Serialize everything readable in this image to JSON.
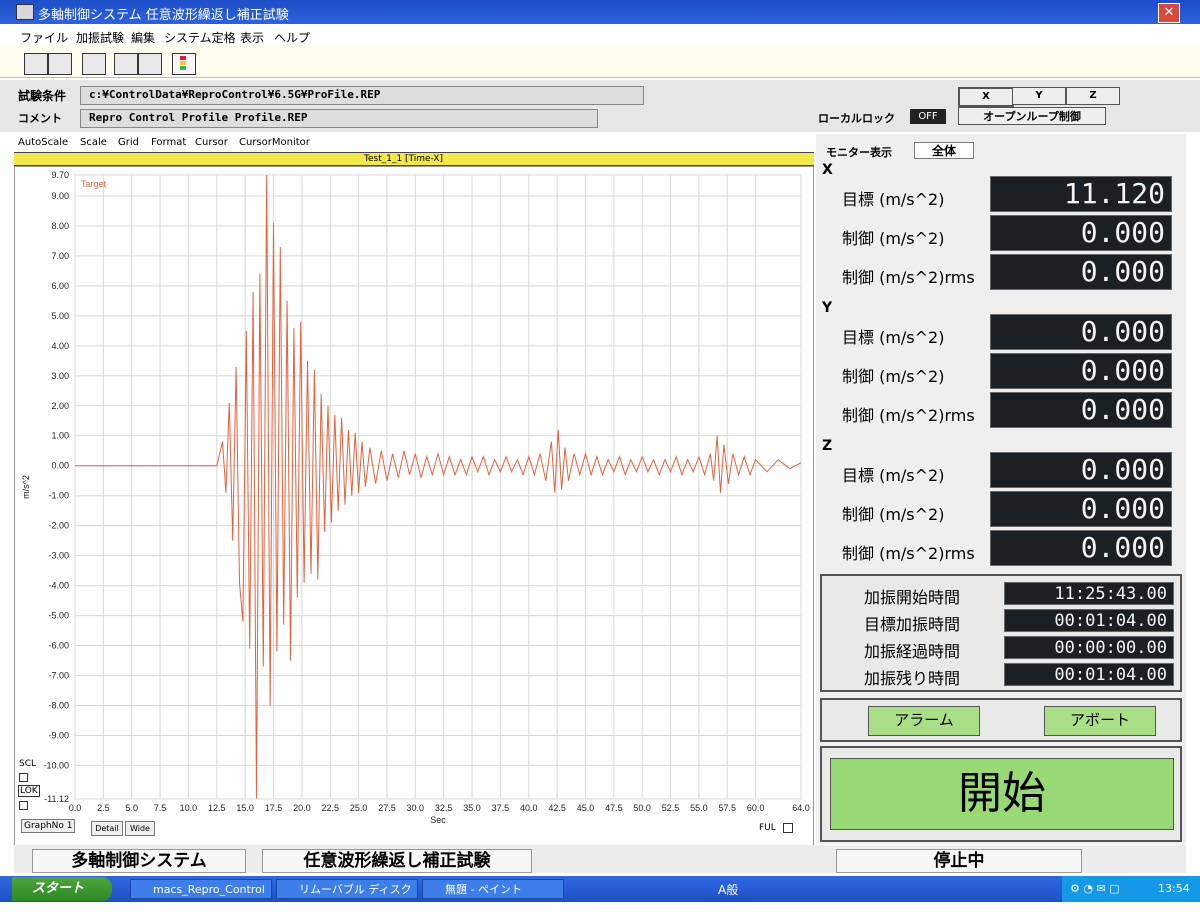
{
  "window": {
    "title": "多軸制御システム 任意波形繰返し補正試験"
  },
  "menu": [
    "ファイル",
    "加振試験",
    "編集",
    "システム定格",
    "表示",
    "ヘルプ"
  ],
  "conditions": {
    "label": "試験条件",
    "path": "c:¥ControlData¥ReproControl¥6.5G¥ProFile.REP",
    "comment_label": "コメント",
    "comment": "Repro Control Profile Profile.REP",
    "local_lock_label": "ローカルロック",
    "local_lock_state": "OFF",
    "open_loop_button": "オープンループ制御"
  },
  "axis_buttons": [
    "X",
    "Y",
    "Z"
  ],
  "graph": {
    "menu": [
      "AutoScale",
      "Scale",
      "Grid",
      "Format",
      "Cursor",
      "CursorMonitor"
    ],
    "title": "Test_1_1 [Time-X]",
    "scl_label": "SCL",
    "lok_label": "LOK",
    "graph_no": "GraphNo 1",
    "detail_button": "Detail",
    "wide_button": "Wide",
    "ful_label": "FUL"
  },
  "chart_data": {
    "type": "line",
    "title": "Test_1_1 [Time-X]",
    "xlabel": "Sec",
    "ylabel": "m/s^2",
    "xlim": [
      0,
      64
    ],
    "ylim": [
      -11.12,
      9.7
    ],
    "x_ticks": [
      "0.0",
      "2.5",
      "5.0",
      "7.5",
      "10.0",
      "12.5",
      "15.0",
      "17.5",
      "20.0",
      "22.5",
      "25.0",
      "27.5",
      "30.0",
      "32.5",
      "35.0",
      "37.5",
      "40.0",
      "42.5",
      "45.0",
      "47.5",
      "50.0",
      "52.5",
      "55.0",
      "57.5",
      "60.0",
      "64.0"
    ],
    "x_tick_values": [
      0,
      2.5,
      5,
      7.5,
      10,
      12.5,
      15,
      17.5,
      20,
      22.5,
      25,
      27.5,
      30,
      32.5,
      35,
      37.5,
      40,
      42.5,
      45,
      47.5,
      50,
      52.5,
      55,
      57.5,
      60,
      64
    ],
    "y_ticks": [
      "9.70",
      "9.00",
      "8.00",
      "7.00",
      "6.00",
      "5.00",
      "4.00",
      "3.00",
      "2.00",
      "1.00",
      "0.00",
      "-1.00",
      "-2.00",
      "-3.00",
      "-4.00",
      "-5.00",
      "-6.00",
      "-7.00",
      "-8.00",
      "-9.00",
      "-10.00",
      "-11.12"
    ],
    "y_tick_values": [
      9.7,
      9,
      8,
      7,
      6,
      5,
      4,
      3,
      2,
      1,
      0,
      -1,
      -2,
      -3,
      -4,
      -5,
      -6,
      -7,
      -8,
      -9,
      -10,
      -11.12
    ],
    "grid": true,
    "legend_position": "top-left",
    "series": [
      {
        "name": "Target",
        "color": "#e8603c",
        "x": [
          0,
          12.5,
          13,
          13.3,
          13.6,
          13.9,
          14.2,
          14.5,
          14.8,
          15.1,
          15.4,
          15.7,
          16.0,
          16.3,
          16.6,
          16.9,
          17.2,
          17.5,
          17.8,
          18.1,
          18.4,
          18.7,
          19.0,
          19.3,
          19.6,
          19.9,
          20.2,
          20.5,
          20.8,
          21.1,
          21.4,
          21.7,
          22.0,
          22.3,
          22.6,
          22.9,
          23.2,
          23.5,
          23.8,
          24.1,
          24.4,
          24.7,
          25.0,
          25.3,
          25.6,
          26.0,
          26.5,
          27.0,
          27.5,
          28.0,
          28.5,
          29.0,
          29.5,
          30.0,
          30.5,
          31.0,
          31.5,
          32.0,
          32.5,
          33.0,
          33.5,
          34.0,
          34.5,
          35.0,
          35.5,
          36.0,
          36.5,
          37.0,
          37.5,
          38.0,
          38.5,
          39.0,
          39.5,
          40.0,
          40.5,
          41.0,
          41.5,
          42.0,
          42.3,
          42.6,
          42.9,
          43.2,
          43.5,
          44.0,
          44.5,
          45.0,
          45.5,
          46.0,
          46.5,
          47.0,
          47.5,
          48.0,
          48.5,
          49.0,
          49.5,
          50.0,
          50.5,
          51.0,
          51.5,
          52.0,
          52.5,
          53.0,
          53.5,
          54.0,
          54.5,
          55.0,
          55.5,
          56.0,
          56.3,
          56.6,
          56.9,
          57.2,
          57.6,
          58.0,
          58.5,
          59.0,
          59.5,
          60.0,
          61.0,
          62.0,
          63.0,
          64.0
        ],
        "y": [
          0,
          0,
          0.8,
          -0.9,
          2.1,
          -2.5,
          3.3,
          -3.9,
          -5.2,
          4.5,
          -6.1,
          5.8,
          -11.1,
          6.4,
          -6.7,
          9.7,
          -8.0,
          8.1,
          -6.2,
          7.3,
          -5.3,
          5.5,
          -6.5,
          4.6,
          -4.4,
          4.8,
          -3.9,
          3.5,
          -3.6,
          3.2,
          -3.8,
          2.4,
          -2.2,
          2.0,
          -1.9,
          1.7,
          -1.5,
          1.6,
          -1.3,
          1.2,
          -1.0,
          1.1,
          -0.9,
          0.8,
          -0.7,
          0.6,
          -0.6,
          0.5,
          -0.5,
          0.4,
          -0.4,
          0.5,
          -0.3,
          0.4,
          -0.4,
          0.3,
          -0.3,
          0.4,
          -0.3,
          0.3,
          -0.3,
          0.2,
          -0.3,
          0.3,
          -0.2,
          0.3,
          -0.3,
          0.2,
          -0.2,
          0.3,
          -0.2,
          0.2,
          -0.3,
          0.3,
          -0.3,
          0.4,
          -0.5,
          0.8,
          -0.9,
          1.2,
          -0.8,
          0.6,
          -0.5,
          0.4,
          -0.3,
          0.4,
          -0.3,
          0.3,
          -0.3,
          0.2,
          -0.2,
          0.3,
          -0.3,
          0.2,
          -0.2,
          0.3,
          -0.2,
          0.2,
          -0.3,
          0.2,
          -0.2,
          0.3,
          -0.3,
          0.2,
          -0.2,
          0.3,
          -0.3,
          0.4,
          -0.5,
          1.0,
          -0.9,
          0.7,
          -0.6,
          0.4,
          -0.3,
          0.3,
          -0.3,
          0.2,
          -0.2,
          0.2,
          -0.1,
          0.1
        ]
      }
    ]
  },
  "monitor": {
    "label": "モニター表示",
    "mode": "全体",
    "axes": [
      {
        "name": "X",
        "rows": [
          {
            "label": "目標 (m/s^2)",
            "value": "11.120"
          },
          {
            "label": "制御 (m/s^2)",
            "value": "0.000"
          },
          {
            "label": "制御 (m/s^2)rms",
            "value": "0.000"
          }
        ]
      },
      {
        "name": "Y",
        "rows": [
          {
            "label": "目標 (m/s^2)",
            "value": "0.000"
          },
          {
            "label": "制御 (m/s^2)",
            "value": "0.000"
          },
          {
            "label": "制御 (m/s^2)rms",
            "value": "0.000"
          }
        ]
      },
      {
        "name": "Z",
        "rows": [
          {
            "label": "目標 (m/s^2)",
            "value": "0.000"
          },
          {
            "label": "制御 (m/s^2)",
            "value": "0.000"
          },
          {
            "label": "制御 (m/s^2)rms",
            "value": "0.000"
          }
        ]
      }
    ],
    "times": [
      {
        "label": "加振開始時間",
        "value": "11:25:43.00"
      },
      {
        "label": "目標加振時間",
        "value": "00:01:04.00"
      },
      {
        "label": "加振経過時間",
        "value": "00:00:00.00"
      },
      {
        "label": "加振残り時間",
        "value": "00:01:04.00"
      }
    ],
    "alarm_button": "アラーム",
    "abort_button": "アボート",
    "start_button": "開始"
  },
  "status": {
    "system": "多軸制御システム",
    "test": "任意波形繰返し補正試験",
    "state": "停止中"
  },
  "taskbar": {
    "start": "スタート",
    "items": [
      "macs_Repro_Control",
      "リムーバブル ディスク (E:)",
      "無題 - ペイント"
    ],
    "ime": "A般",
    "clock": "13:54"
  }
}
